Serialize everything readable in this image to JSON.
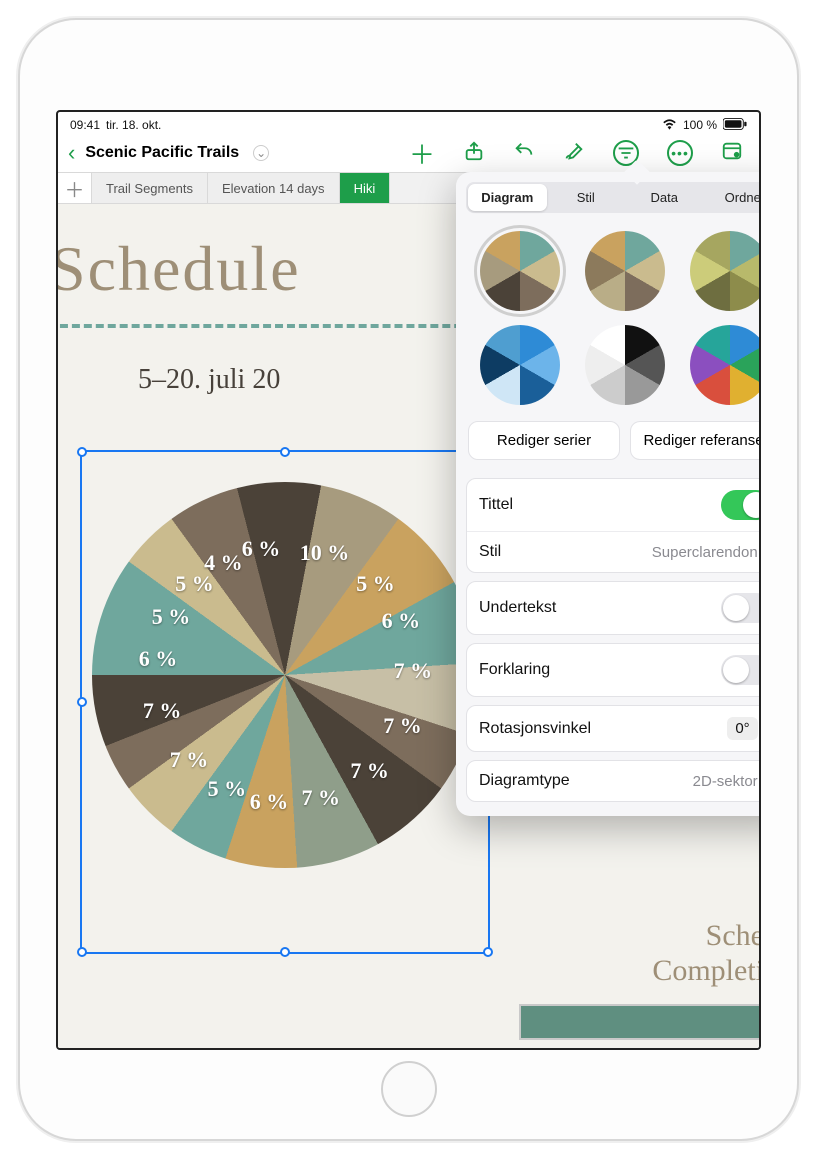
{
  "status": {
    "time": "09:41",
    "date": "tir. 18. okt.",
    "battery_text": "100 %"
  },
  "doc": {
    "title": "Scenic Pacific Trails"
  },
  "sheet_tabs": [
    "Trail Segments",
    "Elevation 14 days",
    "Hiki"
  ],
  "page": {
    "title": "Schedule",
    "subtitle": "5–20. juli 20",
    "side_text_1": "Sched",
    "side_text_2": "Completin"
  },
  "chart_data": {
    "type": "pie",
    "title": "Schedule",
    "values": [
      10,
      5,
      6,
      7,
      7,
      7,
      7,
      6,
      5,
      7,
      7,
      6,
      5,
      5,
      4,
      6
    ],
    "labels_visible": [
      "10 %",
      "4",
      "6 %",
      "7 %",
      "7 %",
      "6 %",
      "5 %",
      "5 %",
      "6 %",
      "7 %",
      "7 %",
      "7 %",
      "7 %",
      "6 %",
      "5 %"
    ],
    "colors_scheme": "earth"
  },
  "popover": {
    "tabs": [
      "Diagram",
      "Stil",
      "Data",
      "Ordne"
    ],
    "active_tab": 0,
    "buttons": {
      "edit_series": "Rediger serier",
      "edit_refs": "Rediger referanser"
    },
    "rows": {
      "title_label": "Tittel",
      "title_on": true,
      "style_label": "Stil",
      "style_value": "Superclarendon",
      "subtitle_label": "Undertekst",
      "subtitle_on": false,
      "legend_label": "Forklaring",
      "legend_on": false,
      "rotation_label": "Rotasjonsvinkel",
      "rotation_value": "0°",
      "type_label": "Diagramtype",
      "type_value": "2D-sektor"
    },
    "thumb_schemes": [
      [
        "#6fa79d",
        "#cabb8e",
        "#7d6d5c",
        "#4b4238",
        "#a79b7e",
        "#c9a25f"
      ],
      [
        "#6fa79d",
        "#cabb8e",
        "#7d6d5c",
        "#b9ad87",
        "#8c7a5c",
        "#c9a25f"
      ],
      [
        "#6fa79d",
        "#b8b96b",
        "#8d8c4b",
        "#6e6e40",
        "#cccc7a",
        "#a6a660"
      ],
      [
        "#2e8bd6",
        "#6cb4ea",
        "#1a5f99",
        "#cfe6f6",
        "#0d3c63",
        "#4f9ed0"
      ],
      [
        "#111",
        "#555",
        "#999",
        "#ccc",
        "#eee",
        "#fff"
      ],
      [
        "#2e8bd6",
        "#2aa35a",
        "#e0b030",
        "#d94f3d",
        "#8b4fbf",
        "#26a59a"
      ]
    ],
    "selected_thumb": 0
  }
}
